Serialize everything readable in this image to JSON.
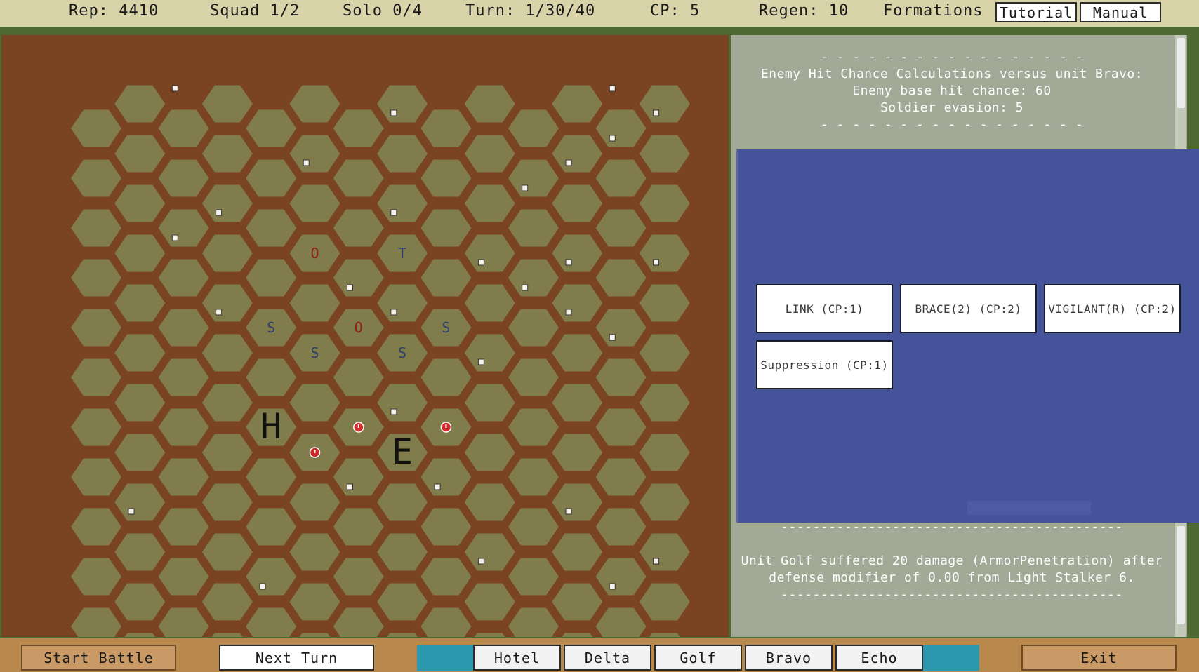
{
  "top": {
    "rep": "Rep: 4410",
    "squad": "Squad 1/2",
    "solo": "Solo 0/4",
    "turn": "Turn: 1/30/40",
    "cp": "CP: 5",
    "regen": "Regen: 10",
    "formations": "Formations",
    "tutorial": "Tutorial",
    "manual": "Manual"
  },
  "board": {
    "cols": 14,
    "rows": 12,
    "hex_fill": "#807c4c",
    "background": "#7a4322",
    "units": [
      {
        "label": "O",
        "col": 5,
        "row": 3,
        "color": "#8f1d1d",
        "size": "small"
      },
      {
        "label": "T",
        "col": 7,
        "row": 3,
        "color": "#2e3f6e",
        "size": "small"
      },
      {
        "label": "S",
        "col": 4,
        "row": 4,
        "color": "#2e3f6e",
        "size": "small"
      },
      {
        "label": "O",
        "col": 6,
        "row": 4,
        "color": "#8f1d1d",
        "size": "small"
      },
      {
        "label": "S",
        "col": 8,
        "row": 4,
        "color": "#2e3f6e",
        "size": "small"
      },
      {
        "label": "S",
        "col": 5,
        "row": 5,
        "color": "#2e3f6e",
        "size": "small"
      },
      {
        "label": "S",
        "col": 7,
        "row": 5,
        "color": "#2e3f6e",
        "size": "small"
      },
      {
        "label": "H",
        "col": 4,
        "row": 6,
        "color": "#111111",
        "size": "large"
      },
      {
        "label": "E",
        "col": 7,
        "row": 7,
        "color": "#111111",
        "size": "large"
      }
    ],
    "alerts": [
      {
        "col": 6,
        "row": 6
      },
      {
        "col": 8,
        "row": 6
      },
      {
        "col": 5,
        "row": 7
      }
    ],
    "markers": [
      {
        "col": 1,
        "row": 0
      },
      {
        "col": 11,
        "row": 0
      },
      {
        "col": 6,
        "row": 0
      },
      {
        "col": 12,
        "row": 0
      },
      {
        "col": 4,
        "row": 1
      },
      {
        "col": 11,
        "row": 1
      },
      {
        "col": 10,
        "row": 1
      },
      {
        "col": 2,
        "row": 2
      },
      {
        "col": 6,
        "row": 2
      },
      {
        "col": 1,
        "row": 3
      },
      {
        "col": 9,
        "row": 2
      },
      {
        "col": 8,
        "row": 3
      },
      {
        "col": 10,
        "row": 3
      },
      {
        "col": 12,
        "row": 3
      },
      {
        "col": 5,
        "row": 4
      },
      {
        "col": 2,
        "row": 4
      },
      {
        "col": 6,
        "row": 4
      },
      {
        "col": 10,
        "row": 4
      },
      {
        "col": 9,
        "row": 4
      },
      {
        "col": 8,
        "row": 5
      },
      {
        "col": 11,
        "row": 5
      },
      {
        "col": 6,
        "row": 6
      },
      {
        "col": 5,
        "row": 8
      },
      {
        "col": 7,
        "row": 8
      },
      {
        "col": 0,
        "row": 8
      },
      {
        "col": 10,
        "row": 8
      },
      {
        "col": 8,
        "row": 9
      },
      {
        "col": 12,
        "row": 9
      },
      {
        "col": 3,
        "row": 10
      },
      {
        "col": 11,
        "row": 10
      }
    ]
  },
  "log": {
    "top_lines": [
      "- - - - - - - - - - - - - - - - -",
      "Enemy Hit Chance Calculations versus unit Bravo:",
      "Enemy base hit chance: 60",
      "Soldier evasion: 5",
      "- - - - - - - - - - - - - - - - -"
    ],
    "bottom_lines": [
      "-------------------------------------------",
      "",
      "Unit Golf suffered 20 damage (ArmorPenetration) after",
      "defense modifier of 0.00 from Light Stalker 6.",
      "-------------------------------------------"
    ]
  },
  "actions": {
    "link": "LINK (CP:1)",
    "brace": "BRACE(2) (CP:2)",
    "vigilant": "VIGILANT(R) (CP:2)",
    "suppression": "Suppression (CP:1)"
  },
  "bottom": {
    "start_battle": "Start Battle",
    "next_turn": "Next Turn",
    "units": [
      "Hotel",
      "Delta",
      "Golf",
      "Bravo",
      "Echo"
    ],
    "exit": "Exit"
  }
}
